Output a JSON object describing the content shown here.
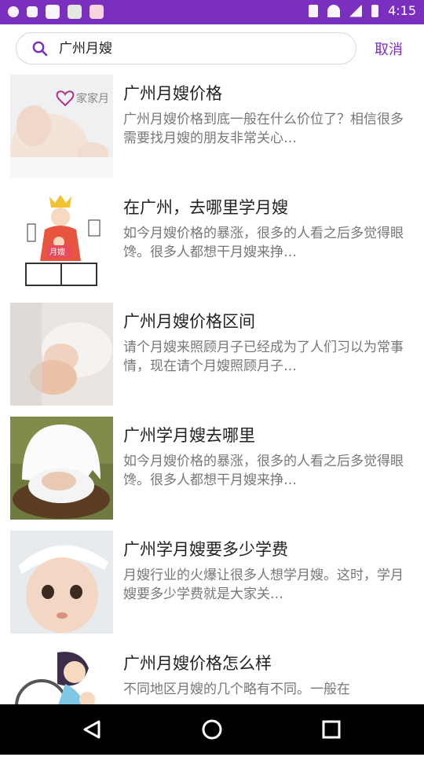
{
  "status_bar": {
    "time": "4:15",
    "accent": "#7b2fbf"
  },
  "search": {
    "query": "广州月嫂",
    "cancel_label": "取消"
  },
  "articles": [
    {
      "title": "广州月嫂价格",
      "desc": "广州月嫂价格到底一般在什么价位了？相信很多需要找月嫂的朋友非常关心…",
      "thumb_logo_text": "家家月"
    },
    {
      "title": "在广州，去哪里学月嫂",
      "desc": "如今月嫂价格的暴涨，很多的人看之后多觉得眼馋。很多人都想干月嫂来挣…",
      "thumb_book_text": "月嫂"
    },
    {
      "title": "广州月嫂价格区间",
      "desc": "请个月嫂来照顾月子已经成为了人们习以为常事情，现在请个月嫂照顾月子…"
    },
    {
      "title": "广州学月嫂去哪里",
      "desc": "如今月嫂价格的暴涨，很多的人看之后多觉得眼馋。很多人都想干月嫂来挣…"
    },
    {
      "title": "广州学月嫂要多少学费",
      "desc": "  月嫂行业的火爆让很多人想学月嫂。这时，学月嫂要多少学费就是大家关…"
    },
    {
      "title": "广州月嫂价格怎么样",
      "desc": "不同地区月嫂的几个略有不同。一般在"
    }
  ]
}
